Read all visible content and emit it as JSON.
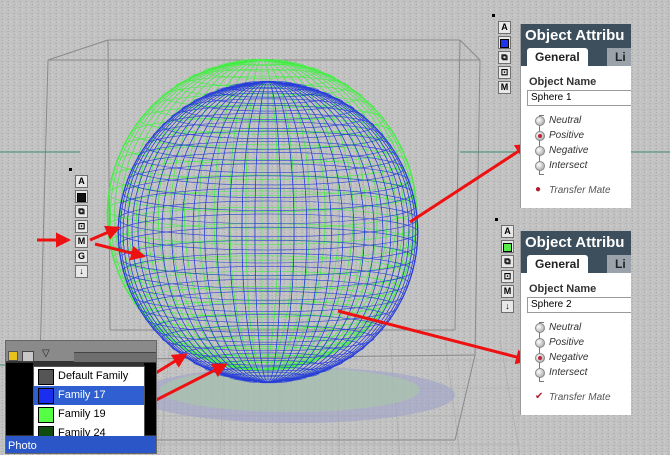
{
  "colors": {
    "background": "#bdbdbd",
    "wire_blue": "#2a3fd8",
    "wire_green": "#44ee44",
    "arrow_red": "#ee1111",
    "panel_header": "#3d4f5d",
    "selection_blue": "#2f5fd0"
  },
  "toolbar_top": {
    "buttons": [
      "A",
      "",
      "",
      "",
      "M"
    ],
    "swatch_color": "#2233ee"
  },
  "toolbar_left": {
    "buttons": [
      "A",
      "",
      "",
      "",
      "M",
      "G",
      ""
    ],
    "swatch_color": "#111111"
  },
  "toolbar_bottom": {
    "buttons": [
      "A",
      "",
      "",
      "",
      "M"
    ],
    "swatch_color": "#55ee44"
  },
  "panel1": {
    "title": "Object Attribu",
    "tab_general": "General",
    "tab_other": "Li",
    "object_name_label": "Object Name",
    "object_name_value": "Sphere 1",
    "options": [
      "Neutral",
      "Positive",
      "Negative",
      "Intersect"
    ],
    "selected": "Positive",
    "transfer_label": "Transfer Mate",
    "transfer_checked": false
  },
  "panel2": {
    "title": "Object Attribu",
    "tab_general": "General",
    "tab_other": "Li",
    "object_name_label": "Object Name",
    "object_name_value": "Sphere 2",
    "options": [
      "Neutral",
      "Positive",
      "Negative",
      "Intersect"
    ],
    "selected": "Negative",
    "transfer_label": "Transfer Mate",
    "transfer_checked": true
  },
  "family_window": {
    "items": [
      {
        "label": "Default Family",
        "color": "#555555",
        "selected": false
      },
      {
        "label": "Family 17",
        "color": "#1a2ef0",
        "selected": true
      },
      {
        "label": "Family 19",
        "color": "#55ff44",
        "selected": false
      },
      {
        "label": "Family 24",
        "color": "#0f4a0f",
        "selected": false
      }
    ],
    "bottom_text": "Photo"
  }
}
